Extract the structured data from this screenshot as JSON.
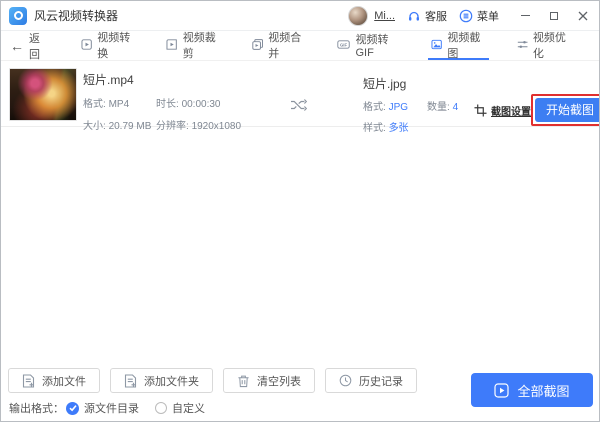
{
  "colors": {
    "accent": "#3e7bfa",
    "annotation_red": "#e02f2f"
  },
  "titlebar": {
    "app_title": "风云视频转换器",
    "user": "Mi...",
    "service_label": "客服",
    "menu_label": "菜单",
    "window_controls": [
      "minimize",
      "maximize",
      "close"
    ]
  },
  "nav": {
    "back_arrow": "←",
    "back_label": "返回",
    "tabs": [
      {
        "label": "视频转换",
        "icon": "play-square-icon",
        "active": false
      },
      {
        "label": "视频裁剪",
        "icon": "crop-play-icon",
        "active": false
      },
      {
        "label": "视频合并",
        "icon": "merge-play-icon",
        "active": false
      },
      {
        "label": "视频转GIF",
        "icon": "gif-icon",
        "active": false
      },
      {
        "label": "视频截图",
        "icon": "image-icon",
        "active": true
      },
      {
        "label": "视频优化",
        "icon": "sliders-icon",
        "active": false
      }
    ]
  },
  "file_row": {
    "source": {
      "name": "短片.mp4",
      "format_label": "格式:",
      "format": "MP4",
      "duration_label": "时长:",
      "duration": "00:00:30",
      "size_label": "大小:",
      "size": "20.79 MB",
      "resolution_label": "分辨率:",
      "resolution": "1920x1080"
    },
    "output": {
      "name": "短片.jpg",
      "format_label": "格式:",
      "format": "JPG",
      "count_label": "数量:",
      "count": "4",
      "style_label": "样式:",
      "style": "多张"
    },
    "settings_label": "截图设置",
    "start_button_label": "开始截图"
  },
  "footer": {
    "buttons": [
      {
        "label": "添加文件",
        "icon": "add-file-icon"
      },
      {
        "label": "添加文件夹",
        "icon": "add-folder-icon"
      },
      {
        "label": "清空列表",
        "icon": "trash-icon"
      },
      {
        "label": "历史记录",
        "icon": "history-icon"
      }
    ],
    "primary_button_label": "全部截图",
    "output_format_label": "输出格式：",
    "radios": [
      {
        "label": "源文件目录",
        "checked": true
      },
      {
        "label": "自定义",
        "checked": false
      }
    ]
  }
}
